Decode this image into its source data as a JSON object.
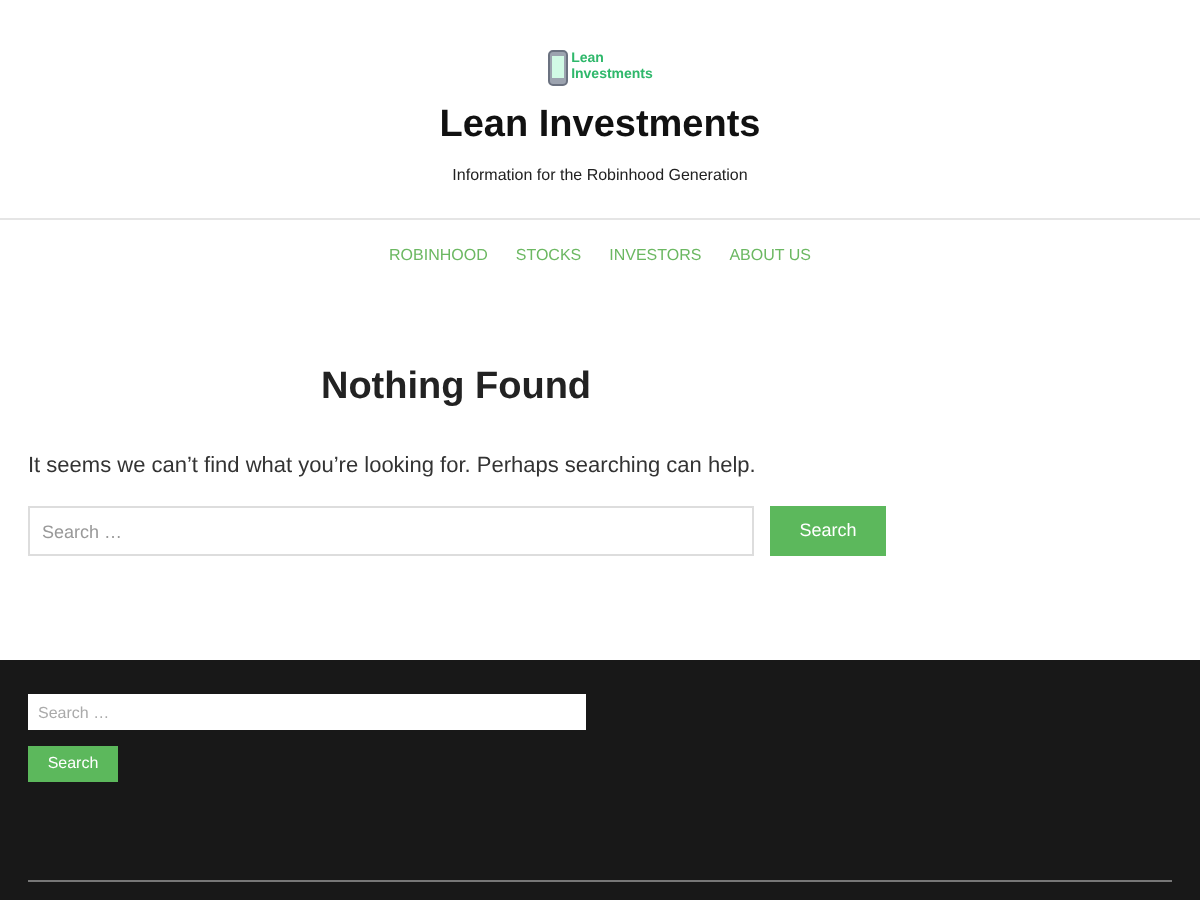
{
  "header": {
    "logo_text": [
      "Lean",
      "Investments"
    ],
    "title": "Lean Investments",
    "tagline": "Information for the Robinhood Generation"
  },
  "nav": {
    "items": [
      {
        "label": "ROBINHOOD"
      },
      {
        "label": "STOCKS"
      },
      {
        "label": "INVESTORS"
      },
      {
        "label": "ABOUT US"
      }
    ]
  },
  "main": {
    "heading": "Nothing Found",
    "message": "It seems we can’t find what you’re looking for. Perhaps searching can help.",
    "search": {
      "placeholder": "Search …",
      "button": "Search"
    }
  },
  "footer": {
    "search": {
      "placeholder": "Search …",
      "button": "Search"
    }
  }
}
